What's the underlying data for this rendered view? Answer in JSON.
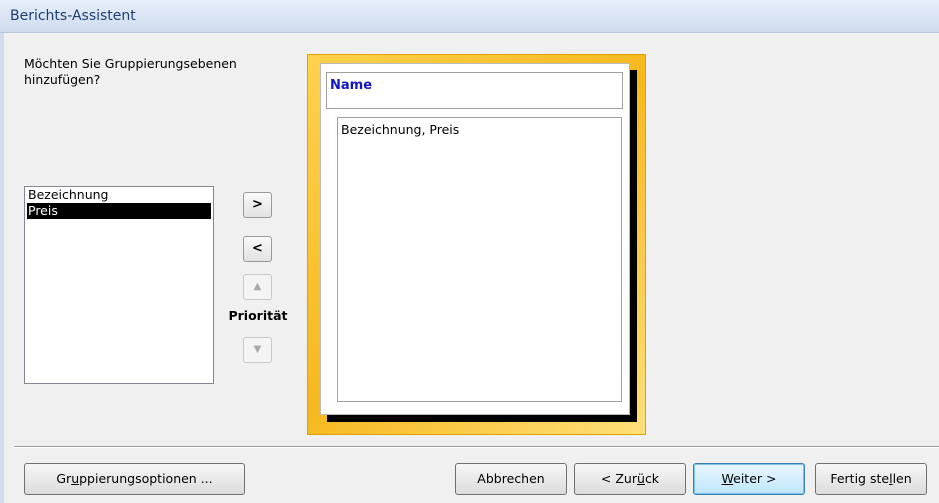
{
  "window": {
    "title": "Berichts-Assistent"
  },
  "prompt": {
    "question": "Möchten Sie Gruppierungsebenen hinzufügen?"
  },
  "fields": {
    "items": [
      {
        "label": "Bezeichnung",
        "selected": false
      },
      {
        "label": "Preis",
        "selected": true
      }
    ]
  },
  "controls": {
    "add_label": ">",
    "remove_label": "<",
    "up_label": "▲",
    "down_label": "▼",
    "priority_label": "Priorität"
  },
  "preview": {
    "group_header": "Name",
    "detail_text": "Bezeichnung, Preis"
  },
  "buttons": {
    "grouping_options": {
      "before": "Gr",
      "mnemonic": "u",
      "after": "ppierungsoptionen ..."
    },
    "cancel": "Abbrechen",
    "back": {
      "before": "< Zur",
      "mnemonic": "ü",
      "after": "ck"
    },
    "next": {
      "before": "",
      "mnemonic": "W",
      "after": "eiter >"
    },
    "finish": {
      "before": "Fertig ste",
      "mnemonic": "l",
      "after": "len"
    }
  },
  "colors": {
    "preview_frame": "#f6b81e",
    "group_header_text": "#1414c8",
    "selection": "#000000"
  }
}
